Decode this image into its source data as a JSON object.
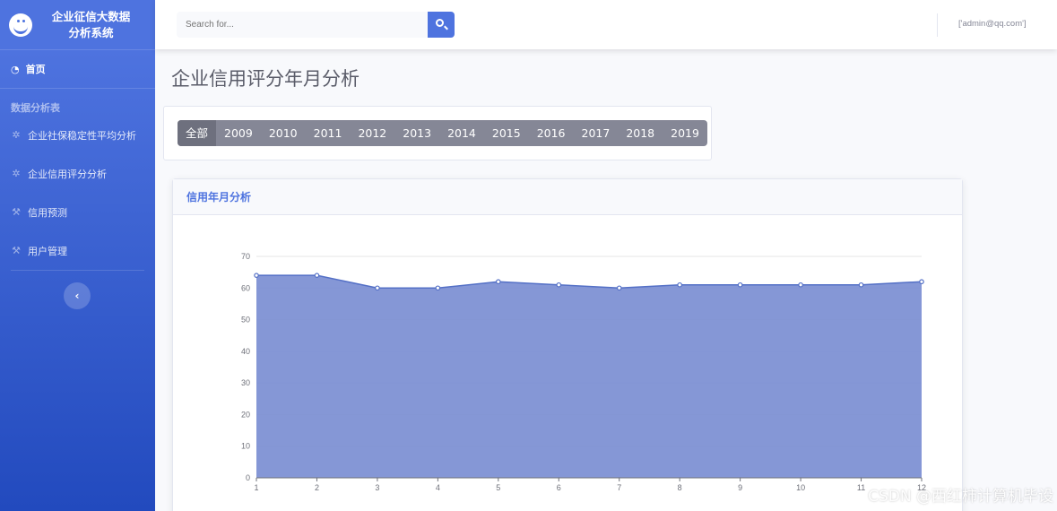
{
  "brand": {
    "line1": "企业征信大数据",
    "line2": "分析系统",
    "logo_icon": "laugh-wink-icon"
  },
  "sidebar": {
    "home": {
      "label": "首页",
      "icon": "dashboard-icon"
    },
    "heading": "数据分析表",
    "items": [
      {
        "label": "企业社保稳定性平均分析",
        "icon": "gear-icon"
      },
      {
        "label": "企业信用评分分析",
        "icon": "gear-icon"
      },
      {
        "label": "信用预测",
        "icon": "wrench-icon"
      },
      {
        "label": "用户管理",
        "icon": "wrench-icon"
      }
    ],
    "toggle_icon": "chevron-left-icon"
  },
  "topbar": {
    "search_placeholder": "Search for...",
    "search_icon": "search-icon",
    "user": "['admin@qq.com']"
  },
  "page": {
    "title": "企业信用评分年月分析"
  },
  "years": {
    "buttons": [
      "全部",
      "2009",
      "2010",
      "2011",
      "2012",
      "2013",
      "2014",
      "2015",
      "2016",
      "2017",
      "2018",
      "2019"
    ],
    "active": "全部"
  },
  "chart_card": {
    "header": "信用年月分析"
  },
  "chart_data": {
    "type": "area",
    "x": [
      1,
      2,
      3,
      4,
      5,
      6,
      7,
      8,
      9,
      10,
      11,
      12
    ],
    "values": [
      64,
      64,
      60,
      60,
      62,
      61,
      60,
      61,
      61,
      61,
      61,
      62
    ],
    "y_ticks": [
      0,
      10,
      20,
      30,
      40,
      50,
      60,
      70
    ],
    "ylim": [
      0,
      70
    ],
    "grid": true,
    "fill_color": "#7b8ed3",
    "line_color": "#5470c6"
  },
  "watermark": "CSDN @西红柿计算机毕设",
  "colors": {
    "primary": "#4e73df",
    "sidebar_gradient_end": "#224abe",
    "year_group": "#858796"
  }
}
